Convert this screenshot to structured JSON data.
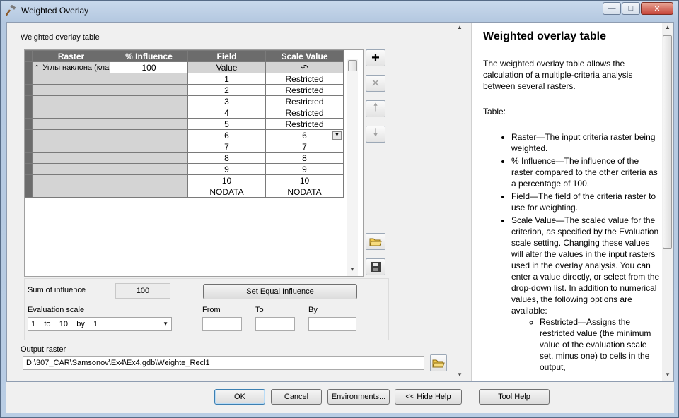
{
  "window": {
    "title": "Weighted Overlay"
  },
  "left": {
    "table_label": "Weighted overlay table",
    "columns": [
      "Raster",
      "% Influence",
      "Field",
      "Scale Value"
    ],
    "first_row": {
      "raster": "Углы наклона (кла",
      "influence": "100",
      "field": "Value"
    },
    "rows": [
      {
        "field": "1",
        "scale": "Restricted"
      },
      {
        "field": "2",
        "scale": "Restricted"
      },
      {
        "field": "3",
        "scale": "Restricted"
      },
      {
        "field": "4",
        "scale": "Restricted"
      },
      {
        "field": "5",
        "scale": "Restricted"
      },
      {
        "field": "6",
        "scale": "6"
      },
      {
        "field": "7",
        "scale": "7"
      },
      {
        "field": "8",
        "scale": "8"
      },
      {
        "field": "9",
        "scale": "9"
      },
      {
        "field": "10",
        "scale": "10"
      },
      {
        "field": "NODATA",
        "scale": "NODATA"
      }
    ],
    "sum_label": "Sum of influence",
    "sum_value": "100",
    "set_equal_label": "Set Equal Influence",
    "eval_label": "Evaluation scale",
    "eval_value": "1    to    10    by    1",
    "from_label": "From",
    "to_label": "To",
    "by_label": "By",
    "output_label": "Output raster",
    "output_value": "D:\\307_CAR\\Samsonov\\Ex4\\Ex4.gdb\\Weighte_Recl1"
  },
  "help": {
    "title": "Weighted overlay table",
    "intro": "The weighted overlay table allows the calculation of a multiple-criteria analysis between several rasters.",
    "table_heading": "Table:",
    "items": [
      "Raster—The input criteria raster being weighted.",
      "% Influence—The influence of the raster compared to the other criteria as a percentage of 100.",
      "Field—The field of the criteria raster to use for weighting.",
      "Scale Value—The scaled value for the criterion, as specified by the Evaluation scale setting. Changing these values will alter the values in the input rasters used in the overlay analysis. You can enter a value directly, or select from the drop-down list. In addition to numerical values, the following options are available:"
    ],
    "subitems": [
      "Restricted—Assigns the restricted value (the minimum value of the evaluation scale set, minus one) to cells in the output,"
    ]
  },
  "buttons": {
    "ok": "OK",
    "cancel": "Cancel",
    "environments": "Environments...",
    "hide_help": "<< Hide Help",
    "tool_help": "Tool Help"
  }
}
